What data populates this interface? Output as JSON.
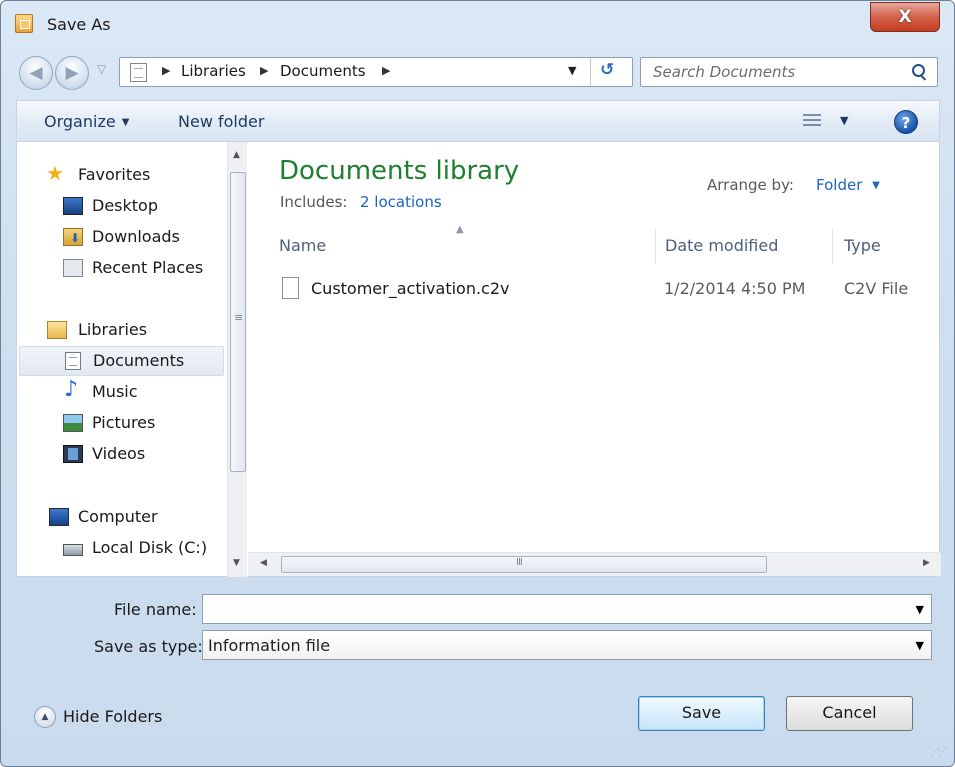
{
  "window": {
    "title": "Save As",
    "close_glyph": "X"
  },
  "navigation": {
    "back_glyph": "◀",
    "forward_glyph": "▶",
    "history_glyph": "▽"
  },
  "address_bar": {
    "path": [
      "Libraries",
      "Documents"
    ],
    "sep": "▶",
    "dropdown_glyph": "▼",
    "refresh_glyph": "↺"
  },
  "search": {
    "placeholder": "Search Documents"
  },
  "command_bar": {
    "organize_label": "Organize",
    "caret": "▼",
    "new_folder_label": "New folder",
    "help_glyph": "?"
  },
  "nav_pane": {
    "favorites": {
      "label": "Favorites",
      "items": [
        "Desktop",
        "Downloads",
        "Recent Places"
      ]
    },
    "libraries": {
      "label": "Libraries",
      "items": [
        "Documents",
        "Music",
        "Pictures",
        "Videos"
      ],
      "selected": "Documents"
    },
    "computer": {
      "label": "Computer",
      "items": [
        "Local Disk (C:)"
      ]
    }
  },
  "content": {
    "library_title": "Documents library",
    "includes_label": "Includes:",
    "locations_link": "2 locations",
    "arrange_label": "Arrange by:",
    "arrange_value": "Folder",
    "columns": [
      "Name",
      "Date modified",
      "Type"
    ],
    "files": [
      {
        "name": "Customer_activation.c2v",
        "date_modified": "1/2/2014 4:50 PM",
        "type": "C2V File"
      }
    ]
  },
  "form": {
    "file_name_label": "File name:",
    "file_name_value": "",
    "save_type_label": "Save as type:",
    "save_type_value": "Information file"
  },
  "footer": {
    "hide_folders_label": "Hide Folders",
    "save_label": "Save",
    "cancel_label": "Cancel"
  },
  "colors": {
    "accent_green": "#1e7f2f",
    "link_blue": "#1c64c3",
    "close_red": "#c33c20"
  }
}
